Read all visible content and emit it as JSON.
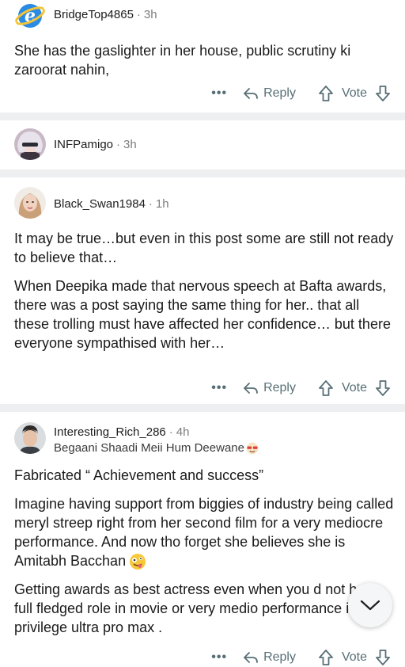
{
  "comments": [
    {
      "username": "BridgeTop4865",
      "age": "3h",
      "body": [
        "She has the gaslighter in her house, public scrutiny ki zaroorat nahin,"
      ],
      "more": "•••",
      "reply": "Reply",
      "vote": "Vote"
    },
    {
      "username": "INFPamigo",
      "age": "3h"
    },
    {
      "username": "Black_Swan1984",
      "age": "1h",
      "body": [
        "It may be true…but even in this post some are still not ready to believe that…",
        "When Deepika made that nervous speech at Bafta awards, there was a post saying the same thing for her.. that all these trolling must have affected her confidence… but there everyone sympathised with her…"
      ],
      "more": "•••",
      "reply": "Reply",
      "vote": "Vote"
    },
    {
      "username": "Interesting_Rich_286",
      "age": "4h",
      "flair": "Begaani Shaadi Meii Hum Deewane",
      "body": [
        "Fabricated “ Achievement and success”",
        "Imagine having support from biggies of industry being called meryl streep right from her second film for a very mediocre performance. And now tho forget she believes she is Amitabh Bacchan",
        "Getting awards as best actress even when you d not have full fledged role in movie or very medio performance is privilege ultra pro max ."
      ],
      "more": "•••",
      "reply": "Reply",
      "vote": "Vote"
    }
  ],
  "colors": {
    "separator": "#edeff1",
    "meta_gray": "#7c7c7c",
    "action_gray": "#576f76",
    "text": "#1a1a1b"
  },
  "icons": {
    "reply": "reply-arrow-icon",
    "upvote": "upvote-arrow-icon",
    "downvote": "downvote-arrow-icon",
    "more": "more-options-icon",
    "scroll": "chevron-down-icon",
    "flair_emoji": "sunglasses-face-emoji",
    "body_emoji": "zany-face-emoji"
  }
}
